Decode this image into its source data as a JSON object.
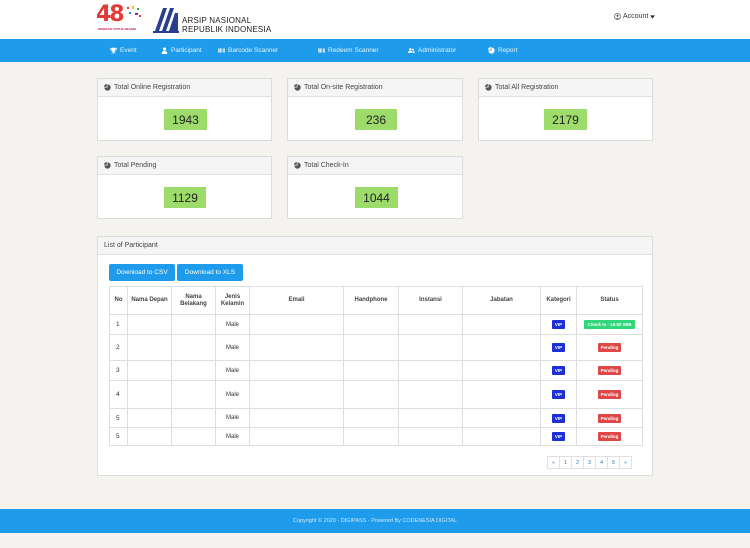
{
  "header": {
    "logo_number": "48",
    "logo_tagline": "DEDIKASI UNTUK NEGERI",
    "org_line1": "ARSIP NASIONAL",
    "org_line2": "REPUBLIK INDONESIA",
    "account_label": "Account"
  },
  "nav": {
    "items": [
      {
        "label": "Event",
        "icon": "trophy-icon"
      },
      {
        "label": "Participant",
        "icon": "user-icon"
      },
      {
        "label": "Barcode Scanner",
        "icon": "barcode-icon"
      },
      {
        "label": "Redeem Scanner",
        "icon": "barcode-icon"
      },
      {
        "label": "Administrator",
        "icon": "users-icon"
      },
      {
        "label": "Report",
        "icon": "pie-chart-icon"
      }
    ]
  },
  "stats": [
    {
      "title": "Total Online Registration",
      "value": "1943"
    },
    {
      "title": "Total On-site Registration",
      "value": "236"
    },
    {
      "title": "Total All Registration",
      "value": "2179"
    },
    {
      "title": "Total Pending",
      "value": "1129"
    },
    {
      "title": "Total Check-In",
      "value": "1044"
    }
  ],
  "participants": {
    "title": "List of Participant",
    "download_csv": "Download to CSV",
    "download_xls": "Download to XLS",
    "columns": [
      "No",
      "Nama Depan",
      "Nama Belakang",
      "Jenis Kelamin",
      "Email",
      "Handphone",
      "Instansi",
      "Jabatan",
      "Kategori",
      "Status"
    ],
    "rows": [
      {
        "no": "1",
        "gender": "Male",
        "kategori": "VIP",
        "status": "Check In - 19.00 WIB"
      },
      {
        "no": "2",
        "gender": "Male",
        "kategori": "VIP",
        "status": "Pending"
      },
      {
        "no": "3",
        "gender": "Male",
        "kategori": "VIP",
        "status": "Pending"
      },
      {
        "no": "4",
        "gender": "Male",
        "kategori": "VIP",
        "status": "Pending"
      },
      {
        "no": "5",
        "gender": "Male",
        "kategori": "VIP",
        "status": "Pending"
      },
      {
        "no": "5",
        "gender": "Male",
        "kategori": "VIP",
        "status": "Pending"
      }
    ],
    "pagination": [
      "«",
      "1",
      "2",
      "3",
      "4",
      "5",
      "»"
    ]
  },
  "footer": {
    "text": "Copyright © 2020 - DIGIPASS - Powered By CODENESIA DIGITAL"
  },
  "colors": {
    "primary": "#1e9bea",
    "stat_green": "#9ddb6a",
    "vip_blue": "#1c2fd8",
    "pending_red": "#e04848",
    "checkin_green": "#2fd67a"
  }
}
